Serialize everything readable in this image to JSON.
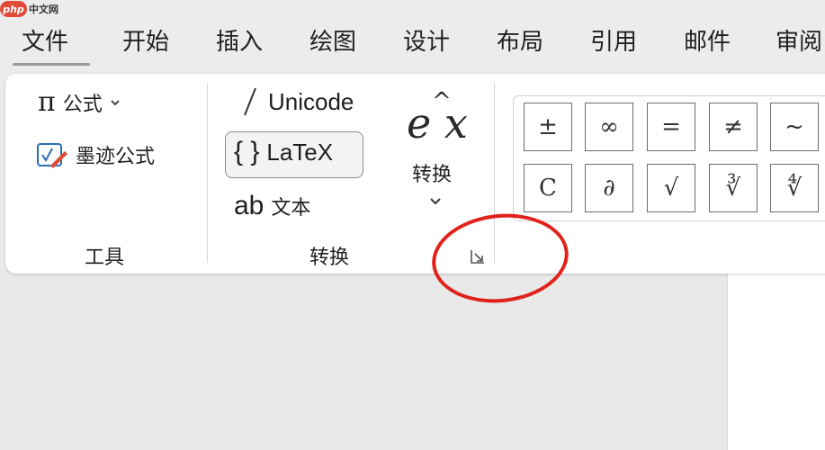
{
  "watermark": {
    "logo": "php",
    "site": "中文网"
  },
  "menu": {
    "tabs": [
      "文件",
      "开始",
      "插入",
      "绘图",
      "设计",
      "布局",
      "引用",
      "邮件",
      "审阅"
    ]
  },
  "tools_group": {
    "equation_label": "公式",
    "ink_equation_label": "墨迹公式",
    "group_label": "工具"
  },
  "convert_group": {
    "unicode_label": "Unicode",
    "latex_label": "LaTeX",
    "text_label": "文本",
    "text_prefix": "ab",
    "convert_label": "转换",
    "group_label": "转换"
  },
  "symbols": {
    "row1": [
      "±",
      "∞",
      "=",
      "≠",
      "~"
    ],
    "row2": [
      "C",
      "∂",
      "√",
      "∛",
      "∜"
    ]
  },
  "colors": {
    "annotation": "#e0221b",
    "accent": "#e04b3a"
  }
}
